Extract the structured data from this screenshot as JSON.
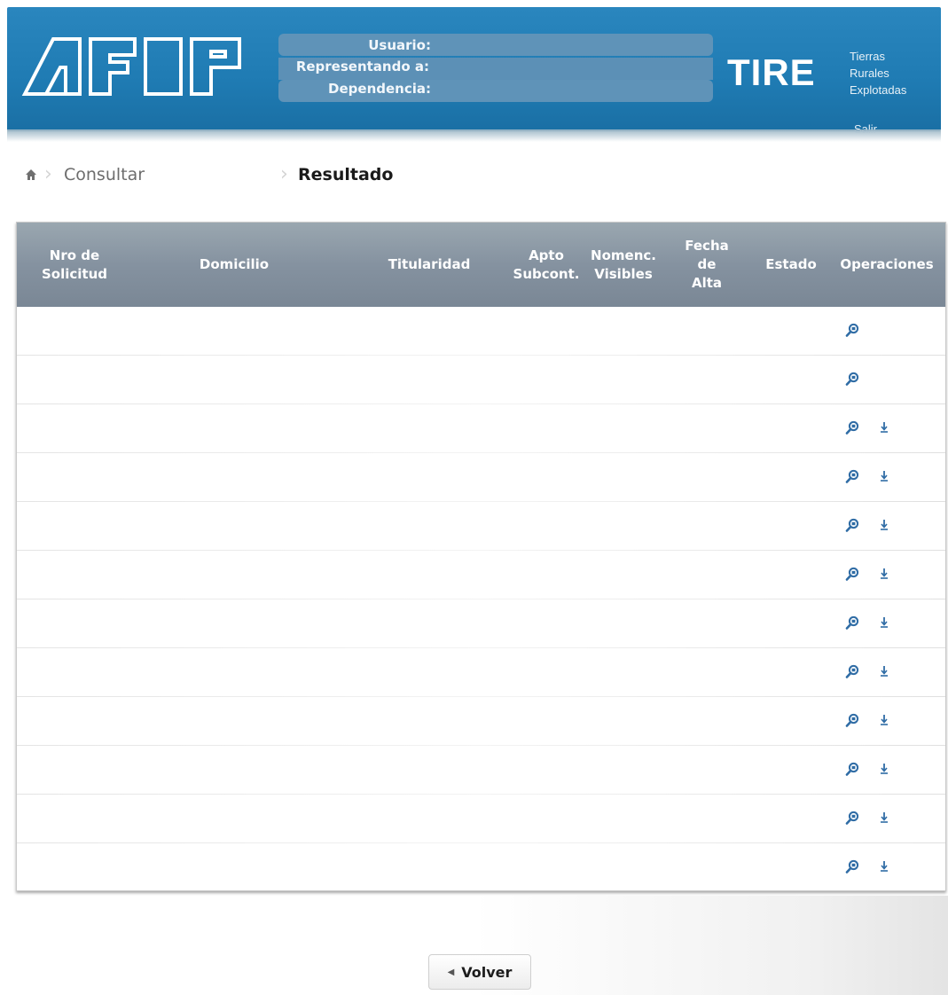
{
  "header": {
    "logo_text": "AFIP",
    "user_label": "Usuario:",
    "represent_label": "Representando a:",
    "dependency_label": "Dependencia:",
    "app_name": "TIRE",
    "app_subtitle_1": "Tierras",
    "app_subtitle_2": "Rurales",
    "app_subtitle_3": "Explotadas",
    "logout_label": "Salir"
  },
  "breadcrumb": {
    "home_icon": "home-icon",
    "step_1": "Consultar",
    "step_2": "Resultado"
  },
  "table": {
    "columns": [
      "Nro de Solicitud",
      "Domicilio",
      "Titularidad",
      "Apto Subcont.",
      "Nomenc. Visibles",
      "Fecha de Alta",
      "Estado",
      "Operaciones"
    ],
    "rows": [
      {
        "ops": [
          "view-icon"
        ]
      },
      {
        "ops": [
          "view-icon"
        ]
      },
      {
        "ops": [
          "view-icon",
          "download-icon"
        ]
      },
      {
        "ops": [
          "view-icon",
          "download-icon"
        ]
      },
      {
        "ops": [
          "view-icon",
          "download-icon"
        ]
      },
      {
        "ops": [
          "view-icon",
          "download-icon"
        ]
      },
      {
        "ops": [
          "view-icon",
          "download-icon"
        ]
      },
      {
        "ops": [
          "view-icon",
          "download-icon"
        ]
      },
      {
        "ops": [
          "view-icon",
          "download-icon"
        ]
      },
      {
        "ops": [
          "view-icon",
          "download-icon"
        ]
      },
      {
        "ops": [
          "view-icon",
          "download-icon"
        ]
      },
      {
        "ops": [
          "view-icon",
          "download-icon"
        ]
      }
    ]
  },
  "footer": {
    "back_label": "Volver"
  },
  "colors": {
    "header_blue": "#1f7bb3",
    "table_header": "#8592a0",
    "icon_blue": "#2f6ca5"
  }
}
